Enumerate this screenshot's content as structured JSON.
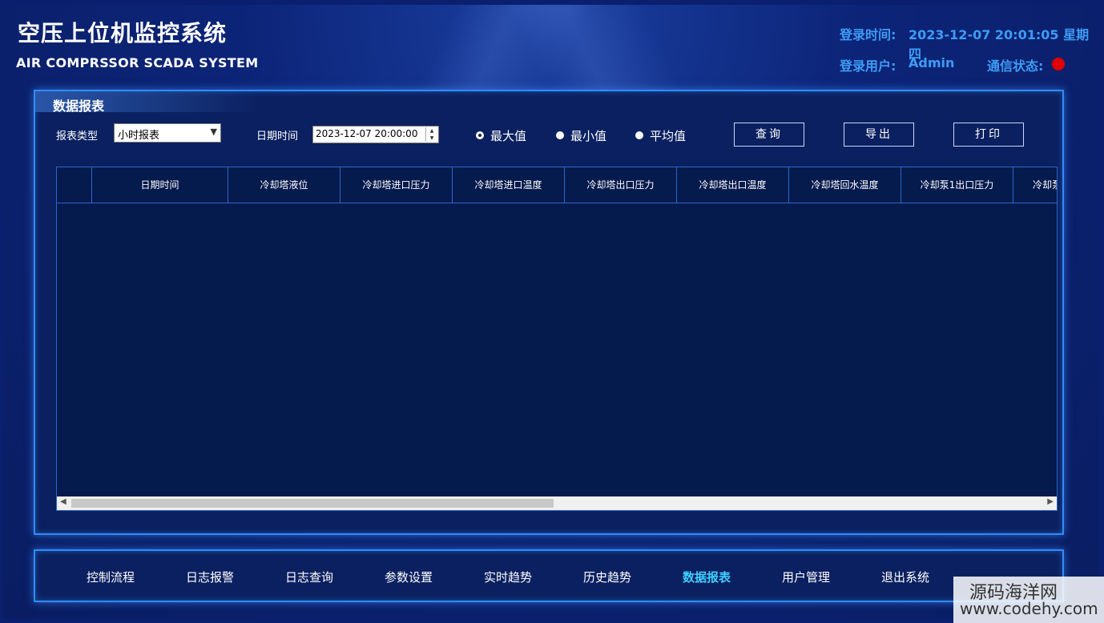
{
  "header": {
    "title_cn": "空压上位机监控系统",
    "title_en": "AIR COMPRSSOR SCADA SYSTEM",
    "login_time_label": "登录时间:",
    "login_time_value": "2023-12-07 20:01:05 星期四",
    "login_user_label": "登录用户:",
    "login_user_value": "Admin",
    "comm_status_label": "通信状态:",
    "comm_status_color": "#e00000"
  },
  "panel": {
    "title": "数据报表",
    "report_type_label": "报表类型",
    "report_type_value": "小时报表",
    "datetime_label": "日期时间",
    "datetime_value": "2023-12-07 20:00:00",
    "radios": [
      {
        "label": "最大值",
        "selected": true
      },
      {
        "label": "最小值",
        "selected": false
      },
      {
        "label": "平均值",
        "selected": false
      }
    ],
    "buttons": {
      "query": "查询",
      "export": "导出",
      "print": "打印"
    }
  },
  "grid": {
    "columns": [
      "",
      "日期时间",
      "冷却塔液位",
      "冷却塔进口压力",
      "冷却塔进口温度",
      "冷却塔出口压力",
      "冷却塔出口温度",
      "冷却塔回水温度",
      "冷却泵1出口压力",
      "冷却泵"
    ],
    "rows": []
  },
  "nav": {
    "items": [
      "控制流程",
      "日志报警",
      "日志查询",
      "参数设置",
      "实时趋势",
      "历史趋势",
      "数据报表",
      "用户管理",
      "退出系统"
    ],
    "active": "数据报表"
  },
  "watermark": {
    "cn": "源码海洋网",
    "en": "www.codehy.com"
  },
  "colors": {
    "accent": "#3d9cf5",
    "active_nav": "#3fd0ff",
    "border": "#2f8cff"
  }
}
